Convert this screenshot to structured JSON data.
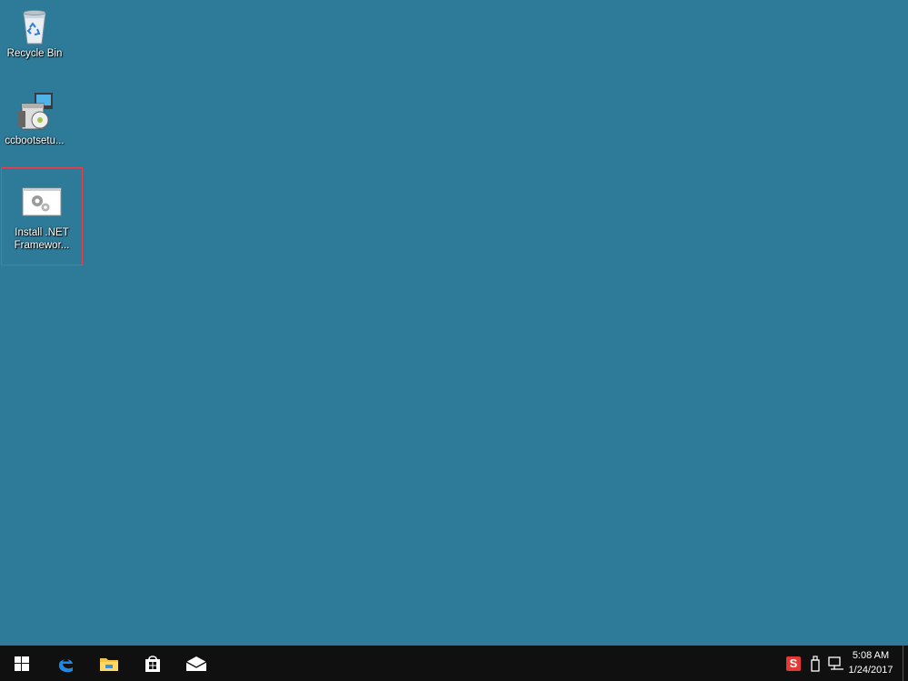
{
  "desktop": {
    "background": "#2d7b99",
    "icons": [
      {
        "label": "Recycle Bin",
        "icon": "recycle-bin-icon"
      },
      {
        "label": "ccbootsetu...",
        "icon": "installer-package-icon"
      },
      {
        "label_line1": "Install .NET",
        "label_line2": "Framewor...",
        "icon": "gear-script-icon",
        "selected": true
      }
    ]
  },
  "taskbar": {
    "apps": [
      {
        "name": "start",
        "icon": "windows-start-icon"
      },
      {
        "name": "edge",
        "icon": "edge-browser-icon"
      },
      {
        "name": "file-explorer",
        "icon": "folder-icon"
      },
      {
        "name": "store",
        "icon": "store-icon"
      },
      {
        "name": "mail",
        "icon": "mail-icon"
      }
    ],
    "tray": {
      "ime_label": "S",
      "time": "5:08 AM",
      "date": "1/24/2017"
    }
  }
}
